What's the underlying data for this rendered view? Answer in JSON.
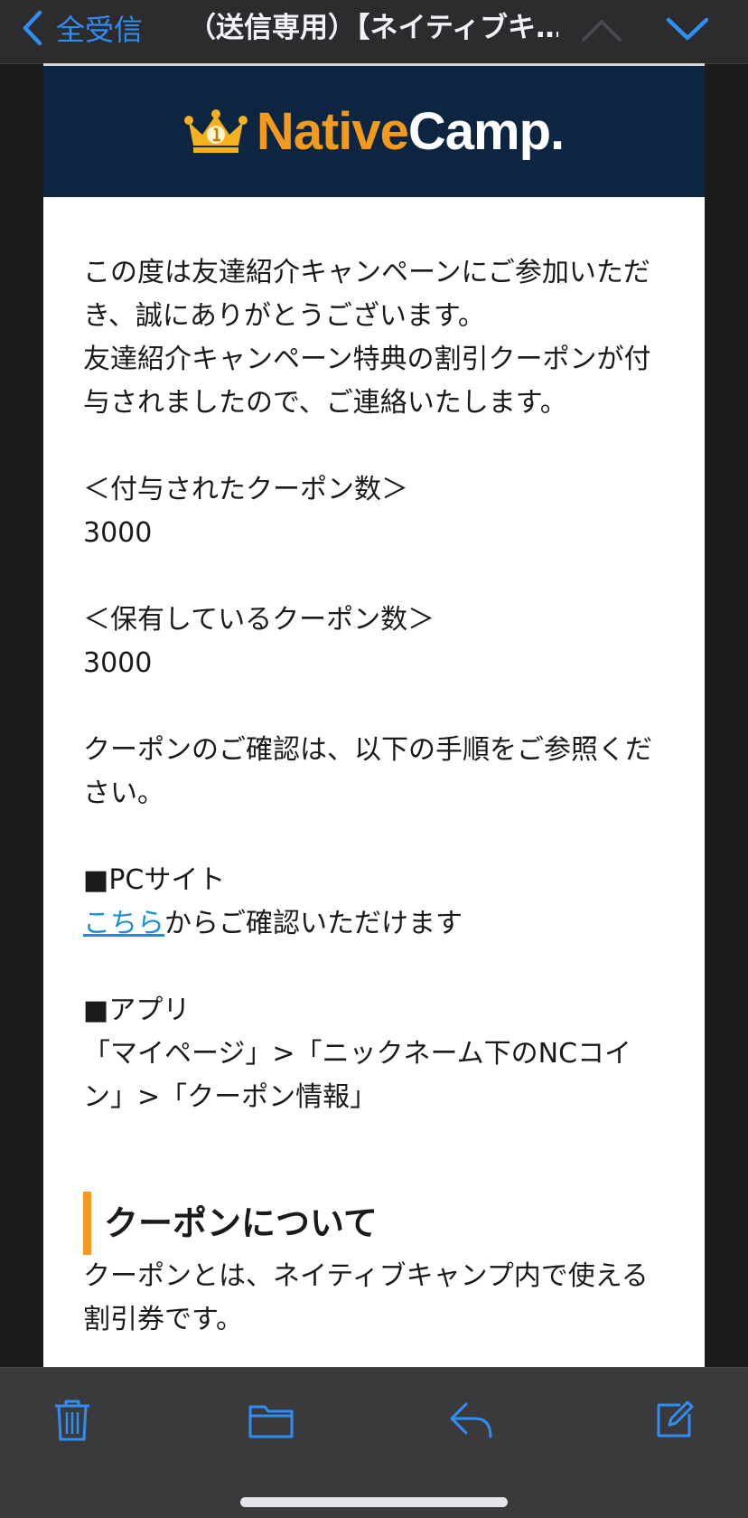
{
  "navbar": {
    "back_label": "全受信",
    "title": "（送信専用）【ネイティブキ…"
  },
  "email": {
    "logo": {
      "native": "Native",
      "camp": "Camp."
    },
    "intro": [
      "この度は友達紹介キャンペーンにご参加いただき、誠にありがとうございます。",
      "友達紹介キャンペーン特典の割引クーポンが付与されましたので、ご連絡いたします。"
    ],
    "granted_label": "＜付与されたクーポン数＞",
    "granted_value": "3000",
    "held_label": "＜保有しているクーポン数＞",
    "held_value": "3000",
    "confirm_text": "クーポンのご確認は、以下の手順をご参照ください。",
    "pc_heading": "■PCサイト",
    "pc_link": "こちら",
    "pc_text": "からご確認いただけます",
    "app_heading": "■アプリ",
    "app_text": "「マイページ」>「ニックネーム下のNCコイン」>「クーポン情報」",
    "section_heading": "クーポンについて",
    "section_text": "クーポンとは、ネイティブキャンプ内で使える割引券です。"
  },
  "toolbar": {
    "icons": [
      "trash-icon",
      "folder-icon",
      "reply-icon",
      "compose-icon"
    ]
  },
  "colors": {
    "accent": "#2f8ef3",
    "brand_orange": "#f39a1d",
    "banner_navy": "#0c2641",
    "link": "#1a8fd6"
  }
}
